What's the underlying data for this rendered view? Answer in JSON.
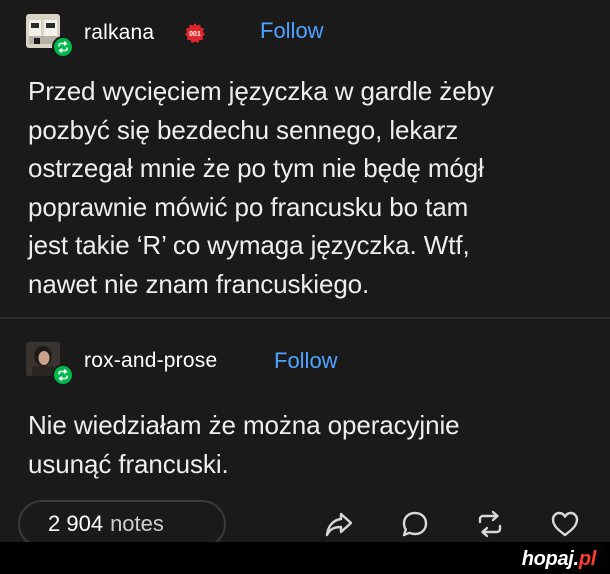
{
  "post1": {
    "username": "ralkana",
    "badge_text": "001",
    "follow_label": "Follow",
    "body": "Przed wycięciem języczka w gardle żeby\npozbyć się bezdechu sennego, lekarz\nostrzegał mnie że po tym nie będę mógł\npoprawnie mówić po francusku bo tam\njest takie ‘R’ co wymaga języczka. Wtf,\nnawet nie znam francuskiego."
  },
  "post2": {
    "username": "rox-and-prose",
    "follow_label": "Follow",
    "body": "Nie wiedziałam że można operacyjnie\nusunąć francuski."
  },
  "footer": {
    "notes_count": "2 904",
    "notes_label": "notes",
    "actions": [
      "share-icon",
      "reply-icon",
      "reblog-icon",
      "like-icon"
    ]
  },
  "watermark": {
    "name": "hopaj",
    "dot": ".",
    "tld": "pl"
  },
  "colors": {
    "background": "#1a1a1a",
    "follow": "#4ea3ff",
    "reblog_badge": "#00b84a",
    "badge_red": "#e0262b",
    "watermark_tld": "#ff3b30"
  }
}
